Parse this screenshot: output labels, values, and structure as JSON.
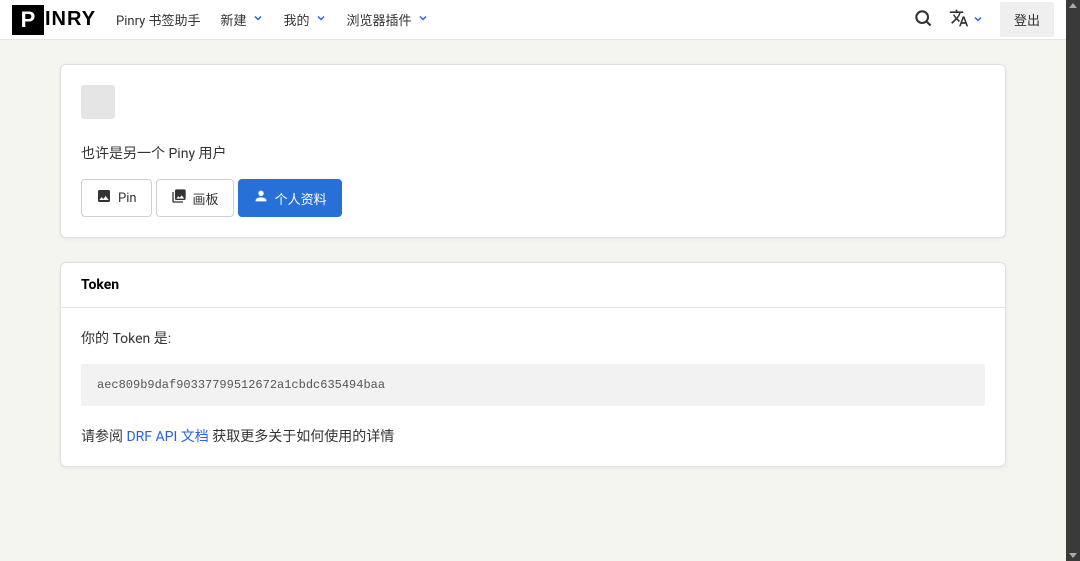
{
  "logo": {
    "letter": "P",
    "rest": "INRY"
  },
  "nav": {
    "bookmarklet": "Pinry 书签助手",
    "create": "新建",
    "mine": "我的",
    "extensions": "浏览器插件"
  },
  "logout": "登出",
  "profile": {
    "desc": "也许是另一个 Piny 用户",
    "tabs": {
      "pin": "Pin",
      "board": "画板",
      "profile": "个人资料"
    }
  },
  "token": {
    "title": "Token",
    "label": "你的 Token 是:",
    "value": "aec809b9daf90337799512672a1cbdc635494baa",
    "footer_prefix": "请参阅 ",
    "footer_link": "DRF API 文档",
    "footer_suffix": " 获取更多关于如何使用的详情"
  }
}
